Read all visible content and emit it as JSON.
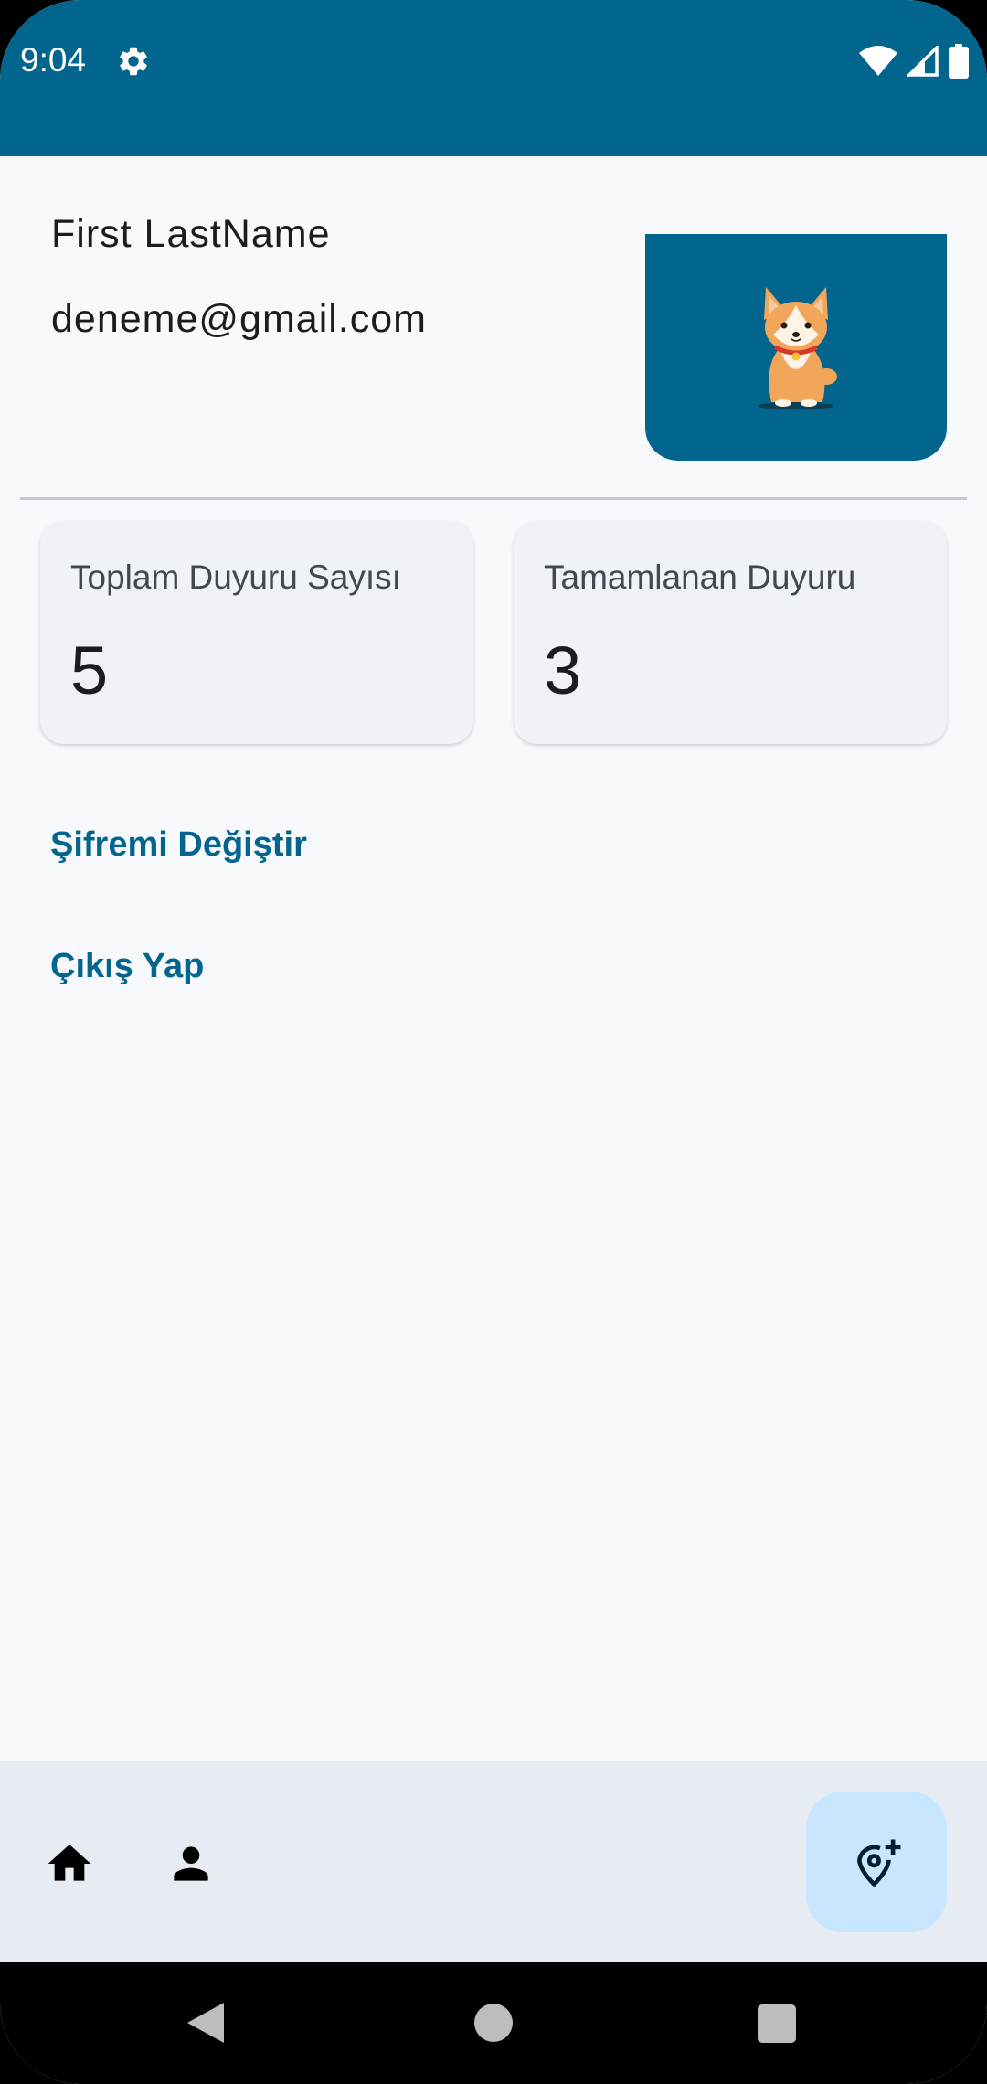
{
  "status_bar": {
    "time": "9:04",
    "icons": [
      "settings-gear-icon",
      "wifi-icon",
      "cellular-signal-icon",
      "battery-icon"
    ]
  },
  "profile": {
    "name": "First LastName",
    "email": "deneme@gmail.com",
    "avatar_icon": "corgi-dog-illustration"
  },
  "stats": {
    "total_label": "Toplam Duyuru Sayısı",
    "total_value": "5",
    "completed_label": "Tamamlanan Duyuru",
    "completed_value": "3"
  },
  "actions": {
    "change_password": "Şifremi Değiştir",
    "logout": "Çıkış Yap"
  },
  "bottom_nav": {
    "items": [
      "home-icon",
      "person-icon"
    ],
    "fab_icon": "add-location-icon"
  },
  "system_nav": [
    "back-icon",
    "home-circle-icon",
    "recents-square-icon"
  ],
  "colors": {
    "primary": "#02658E",
    "surface": "#F8F9FC",
    "card": "#EFF2F6",
    "bottom_bar": "#E7ECF2",
    "fab": "#C9E6FF"
  }
}
